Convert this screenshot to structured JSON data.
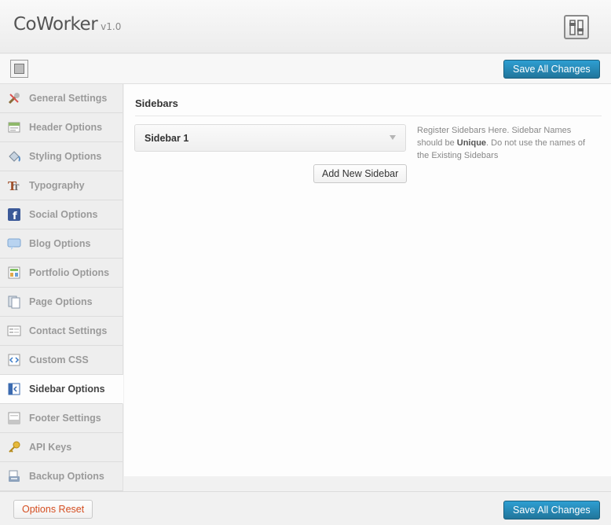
{
  "app": {
    "name": "CoWorker",
    "version": "v1.0"
  },
  "toolbar": {
    "save_label": "Save All Changes"
  },
  "sidebar": {
    "items": [
      {
        "label": "General Settings",
        "icon": "wrench-icon",
        "active": false
      },
      {
        "label": "Header Options",
        "icon": "header-icon",
        "active": false
      },
      {
        "label": "Styling Options",
        "icon": "paint-bucket-icon",
        "active": false
      },
      {
        "label": "Typography",
        "icon": "typography-icon",
        "active": false
      },
      {
        "label": "Social Options",
        "icon": "facebook-icon",
        "active": false
      },
      {
        "label": "Blog Options",
        "icon": "speech-bubble-icon",
        "active": false
      },
      {
        "label": "Portfolio Options",
        "icon": "portfolio-icon",
        "active": false
      },
      {
        "label": "Page Options",
        "icon": "page-icon",
        "active": false
      },
      {
        "label": "Contact Settings",
        "icon": "contact-form-icon",
        "active": false
      },
      {
        "label": "Custom CSS",
        "icon": "code-icon",
        "active": false
      },
      {
        "label": "Sidebar Options",
        "icon": "sidebar-icon",
        "active": true
      },
      {
        "label": "Footer Settings",
        "icon": "footer-icon",
        "active": false
      },
      {
        "label": "API Keys",
        "icon": "key-icon",
        "active": false
      },
      {
        "label": "Backup Options",
        "icon": "backup-icon",
        "active": false
      }
    ]
  },
  "main": {
    "section_title": "Sidebars",
    "sidebar_select": {
      "value": "Sidebar 1"
    },
    "add_button_label": "Add New Sidebar",
    "help": {
      "pre": "Register Sidebars Here. Sidebar Names should be ",
      "strong": "Unique",
      "post": ". Do not use the names of the Existing Sidebars"
    }
  },
  "footer": {
    "reset_label": "Options Reset",
    "save_label": "Save All Changes"
  },
  "colors": {
    "primary_button": "#21759b",
    "reset_text": "#d54e21",
    "active_nav_bg": "#fdfdfd"
  }
}
